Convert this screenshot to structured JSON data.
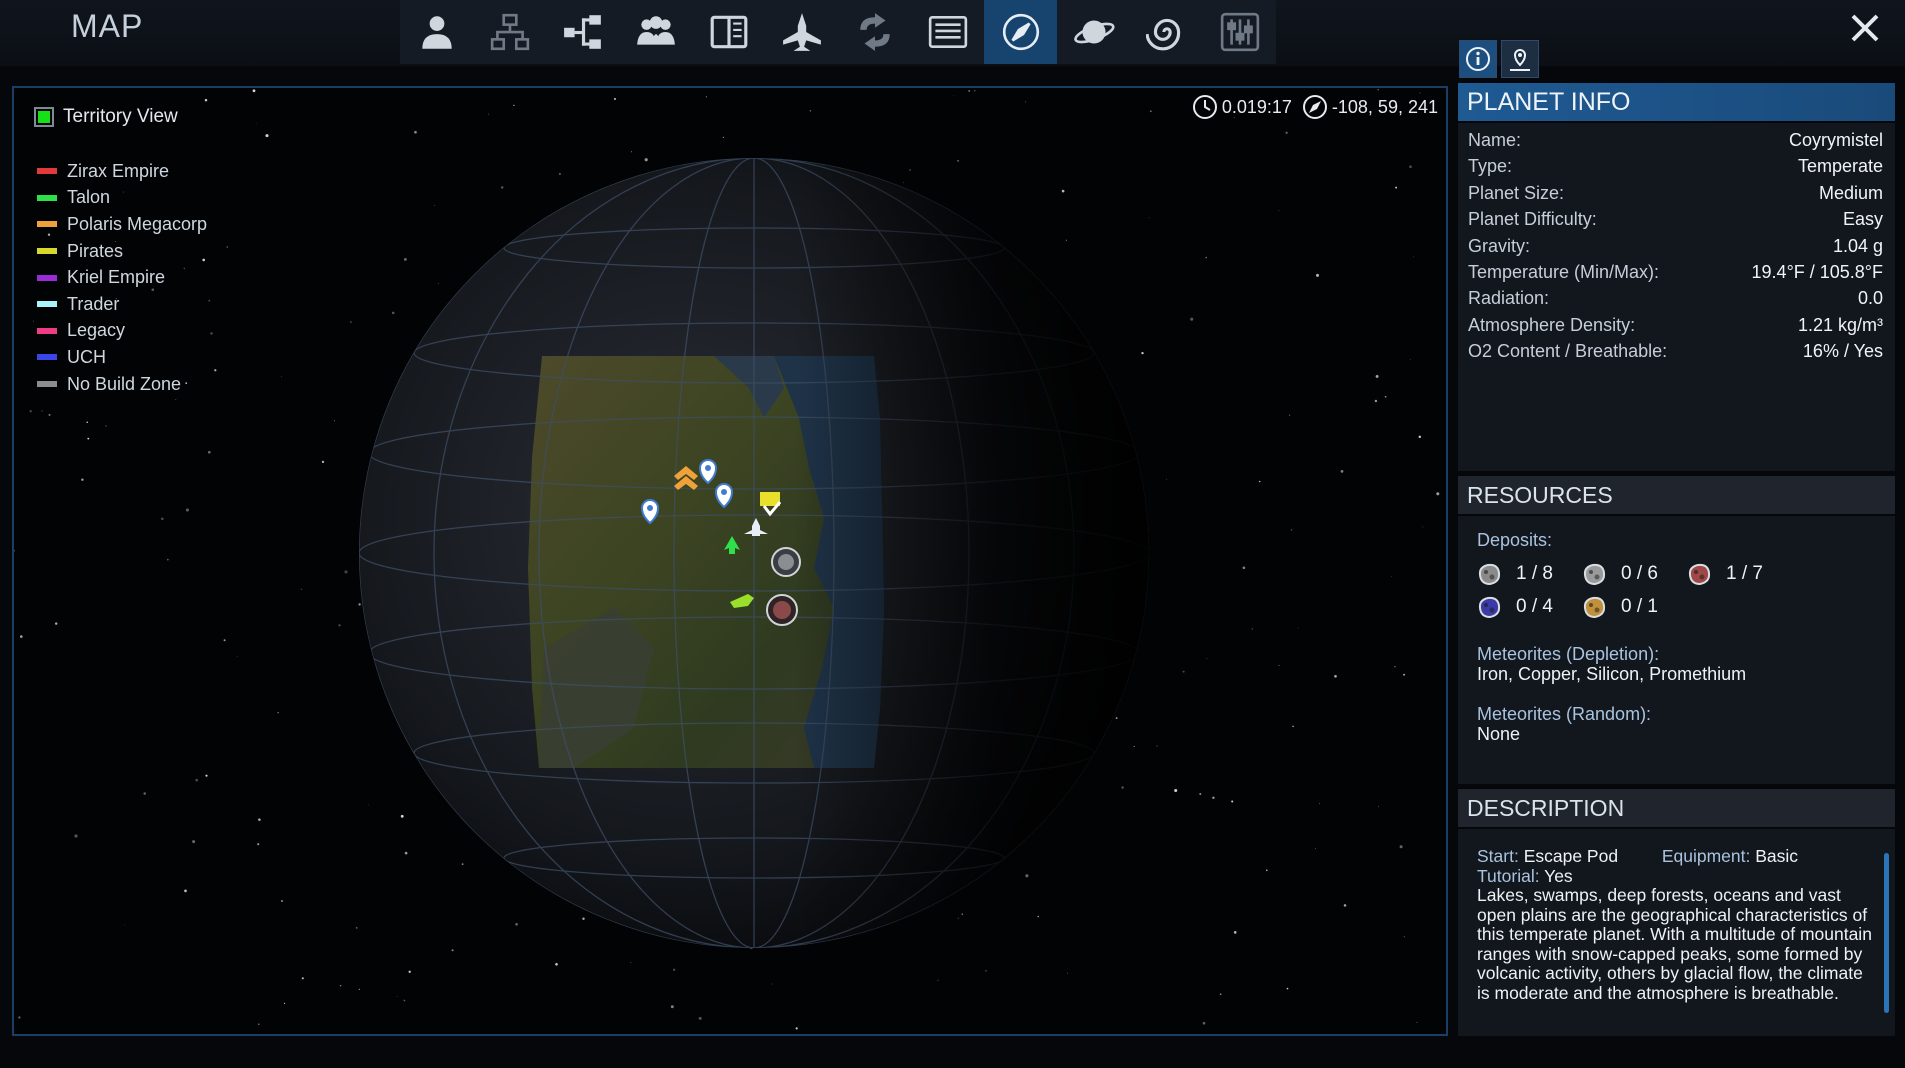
{
  "window": {
    "title": "MAP"
  },
  "toolbar": {
    "icons": [
      "player-icon",
      "structures-icon",
      "tech-tree-icon",
      "faction-icon",
      "codex-icon",
      "spaceship-icon",
      "swap-icon",
      "log-icon",
      "compass-icon",
      "planet-icon",
      "galaxy-icon",
      "settings-icon"
    ],
    "active": "compass-icon"
  },
  "legend": {
    "title": "Territory View",
    "checked": true,
    "items": [
      {
        "label": "Zirax Empire",
        "color": "#e23a3a"
      },
      {
        "label": "Talon",
        "color": "#2ee04a"
      },
      {
        "label": "Polaris Megacorp",
        "color": "#f0a23a"
      },
      {
        "label": "Pirates",
        "color": "#d8d82c"
      },
      {
        "label": "Kriel Empire",
        "color": "#9b2ad8"
      },
      {
        "label": "Trader",
        "color": "#a8f4f8"
      },
      {
        "label": "Legacy",
        "color": "#ee3c86"
      },
      {
        "label": "UCH",
        "color": "#3a46e6"
      },
      {
        "label": "No Build Zone",
        "color": "#8c8c8c"
      }
    ]
  },
  "hud": {
    "time": "0.019:17",
    "coords": "-108, 59, 241"
  },
  "planet_info": {
    "title": "PLANET INFO",
    "rows": [
      {
        "key": "Name:",
        "value": "Coyrymistel"
      },
      {
        "key": "Type:",
        "value": "Temperate"
      },
      {
        "key": "Planet Size:",
        "value": "Medium"
      },
      {
        "key": "Planet Difficulty:",
        "value": "Easy"
      },
      {
        "key": "Gravity:",
        "value": "1.04 g"
      },
      {
        "key": "Temperature (Min/Max):",
        "value": "19.4°F / 105.8°F"
      },
      {
        "key": "Radiation:",
        "value": "0.0"
      },
      {
        "key": "Atmosphere Density:",
        "value": "1.21 kg/m³"
      },
      {
        "key": "O2 Content / Breathable:",
        "value": "16% / Yes"
      }
    ]
  },
  "resources": {
    "title": "RESOURCES",
    "deposits_label": "Deposits:",
    "deposits": [
      {
        "icon": "iron-ore-icon",
        "count": "1 / 8",
        "color": "#8a8a8a"
      },
      {
        "icon": "copper-ore-icon",
        "count": "0 / 6",
        "color": "#9a9a9a"
      },
      {
        "icon": "magmatic-ore-icon",
        "count": "1 / 7",
        "color": "#a04848"
      },
      {
        "icon": "crystal-ore-icon",
        "count": "0 / 4",
        "color": "#3a3aa8"
      },
      {
        "icon": "sand-icon",
        "count": "0 / 1",
        "color": "#c0903a"
      }
    ],
    "meteor_depletion_label": "Meteorites (Depletion):",
    "meteor_depletion": "Iron, Copper, Silicon, Promethium",
    "meteor_random_label": "Meteorites (Random):",
    "meteor_random": "None"
  },
  "description": {
    "title": "DESCRIPTION",
    "start_label": "Start:",
    "start": "Escape Pod",
    "equipment_label": "Equipment:",
    "equipment": "Basic",
    "tutorial_label": "Tutorial:",
    "tutorial": "Yes",
    "text": "Lakes, swamps, deep forests, oceans and vast open plains are the geographical characteristics of this temperate planet. With a multitude of mountain ranges with snow-capped peaks, some formed by volcanic activity, others by glacial flow, the climate is moderate and the atmosphere is breathable."
  }
}
